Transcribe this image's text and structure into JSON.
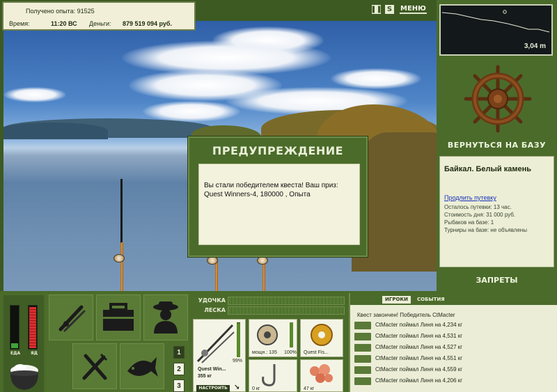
{
  "info": {
    "xp_label": "Получено опыта:",
    "xp_value": "91525",
    "time_label": "Время:",
    "time_value": "11:20 ВС",
    "money_label": "Деньги:",
    "money_value": "879 519 094 руб."
  },
  "top_controls": {
    "pause_icon": "pause-icon",
    "sound_icon": "sound-icon",
    "menu_label": "МЕНЮ"
  },
  "map": {
    "depth": "3,04 m"
  },
  "base": {
    "return_label": "ВЕРНУТЬСЯ НА БАЗУ",
    "location_title": "Байкал. Белый камень",
    "extend_link": "Продлить путевку",
    "lines": [
      "Осталось путевки: 13 час.",
      "Стоимость дня: 31 000 руб.",
      "Рыбаков на базе: 1",
      "Турниры на базе: не объявлены"
    ],
    "bans_label": "ЗАПРЕТЫ"
  },
  "dialog": {
    "title": "ПРЕДУПРЕЖДЕНИЕ",
    "message": "Вы стали победителем квеста! Ваш приз: Quest Winners-4, 180000 , Опыта"
  },
  "status": {
    "food_label": "ЕДА",
    "food_level": 0.12,
    "poison_label": "ЯД",
    "poison_level": 0.95
  },
  "actions": {
    "items": [
      "rods-icon",
      "tackle-box-icon",
      "fisherman-icon",
      "food-icon",
      "fish-icon"
    ],
    "numbers": [
      "1",
      "2",
      "3"
    ],
    "active_number": "1"
  },
  "gear": {
    "rod_label": "УДОЧКА",
    "line_label": "ЛЕСКА",
    "rod_name": "Quest Win...",
    "rod_weight": "355 кг",
    "rod_pct": "99%",
    "setup_label": "НАСТРОИТЬ",
    "reel_power": "мощн.: 135",
    "reel_pct": "100%",
    "line_name": "Quest Fis...",
    "hook_caption": "0 кг",
    "bait_caption": "47 кг"
  },
  "log": {
    "tab_players": "ИГРОКИ",
    "tab_events": "СОБЫТИЯ",
    "header": "Квест закончен! Победитель CtMacter",
    "rows": [
      "CtMacter поймал Линя на 4,234 кг",
      "CtMacter поймал Линя на 4,531 кг",
      "CtMacter поймал Линя на 4,527 кг",
      "CtMacter поймал Линя на 4,551 кг",
      "CtMacter поймал Линя на 4,559 кг",
      "CtMacter поймал Линя на 4,206 кг"
    ]
  }
}
